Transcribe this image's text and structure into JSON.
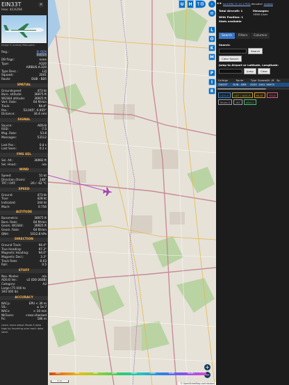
{
  "aircraft": {
    "callsign": "EIN33T",
    "hex_line": "Hex: 4CA294",
    "photo_credit": "Image © Andrzej Mahusatch",
    "hide_icon": "close-icon"
  },
  "info_rows": [
    {
      "k": "Reg.:",
      "v": "EI-DEN",
      "link": true
    },
    {
      "k": "",
      "v": "Ireland"
    },
    {
      "k": "DB flags:",
      "v": "none"
    },
    {
      "k": "Type:",
      "v": "A320"
    },
    {
      "k": "",
      "v": "AIRBUS A-320"
    },
    {
      "k": "Type Desc.:",
      "v": "L2J"
    },
    {
      "k": "Squawk:",
      "v": "2041"
    },
    {
      "k": "Route:",
      "v": "DUB - BER"
    }
  ],
  "sections": [
    {
      "title": "SPATIAL",
      "rows": [
        {
          "k": "Groundspeed:",
          "v": "473 kt"
        },
        {
          "k": "Baro. altitude:",
          "v": "36975 ft"
        },
        {
          "k": "WGS84 altitude:",
          "v": "36925 ft"
        },
        {
          "k": "Vert. Rate:",
          "v": "64 ft/min"
        },
        {
          "k": "Track:",
          "v": "94.4°"
        },
        {
          "k": "Pos.:",
          "v": "53.045°, 6.955°"
        },
        {
          "k": "Distance:",
          "v": "34.4 nmi"
        }
      ]
    },
    {
      "title": "SIGNAL",
      "rows": [
        {
          "k": "Source:",
          "v": "ADS-B"
        },
        {
          "k": "RSSI:",
          "v": "-7.5"
        },
        {
          "k": "Msg. Rate:",
          "v": "53.8"
        },
        {
          "k": "Messages:",
          "v": "53112"
        },
        {
          "k": "",
          "v": ""
        },
        {
          "k": "Last Pos.:",
          "v": "0.4 s"
        },
        {
          "k": "Last Seen:",
          "v": "0.1 s"
        }
      ]
    },
    {
      "title": "FMS SEL",
      "rows": [
        {
          "k": "Sel. Alt.:",
          "v": "36992 ft"
        },
        {
          "k": "Sel. Head.:",
          "v": "n/a"
        }
      ]
    },
    {
      "title": "WIND",
      "rows": [
        {
          "k": "Speed:",
          "v": "51 kt"
        },
        {
          "k": "Direction (from):",
          "v": "248°"
        },
        {
          "k": "TAT / OAT:",
          "v": "-26 / -62 °C"
        }
      ]
    },
    {
      "title": "SPEED",
      "rows": [
        {
          "k": "Ground:",
          "v": "473 kt"
        },
        {
          "k": "True:",
          "v": "428 kt"
        },
        {
          "k": "Indicated:",
          "v": "244 kt"
        },
        {
          "k": "Mach:",
          "v": "0.756"
        }
      ]
    },
    {
      "title": "ALTITUDE",
      "rows": [
        {
          "k": "Barometric:",
          "v": "36975 ft"
        },
        {
          "k": "Baro. Rate:",
          "v": "64 ft/min"
        },
        {
          "k": "Geom. WGS84:",
          "v": "36925 ft"
        },
        {
          "k": "Geom. Rate:",
          "v": "64 ft/min"
        },
        {
          "k": "QNH:",
          "v": "1012.8 hPa"
        }
      ]
    },
    {
      "title": "DIRECTION",
      "rows": [
        {
          "k": "Ground Track:",
          "v": "94.4°"
        },
        {
          "k": "True Heading:",
          "v": "97.3°"
        },
        {
          "k": "Magnetic Heading:",
          "v": "94.0°"
        },
        {
          "k": "Magnetic Decl.:",
          "v": "3.3°"
        },
        {
          "k": "Track Rate:",
          "v": "-0.03"
        },
        {
          "k": "Roll:",
          "v": "0.5"
        }
      ]
    },
    {
      "title": "STUFF",
      "rows": [
        {
          "k": "Nav. Modes:",
          "v": "n/a"
        },
        {
          "k": "ADS-B Ver.:",
          "v": "v2 (DO-260B)"
        },
        {
          "k": "Category:",
          "v": "A3"
        },
        {
          "k": "Large (75 000 to",
          "v": ""
        },
        {
          "k": "300 000 lb)",
          "v": ""
        }
      ]
    },
    {
      "title": "ACCURACY",
      "rows": [
        {
          "k": "NACp:",
          "v": "EPU < 30 m"
        },
        {
          "k": "SIL:",
          "v": "≤ 1e-7"
        },
        {
          "k": "NACv:",
          "v": "< 10 m/s"
        },
        {
          "k": "NICbaro:",
          "v": "cross-checked"
        },
        {
          "k": "Rc:",
          "v": "186 m"
        }
      ]
    }
  ],
  "footer": "Learn more about Mode-S data tags by hovering over each data label.",
  "map": {
    "top_buttons": [
      "U",
      "H",
      "T"
    ],
    "side_buttons": [
      "L",
      "O",
      "K",
      "M",
      "P",
      "I",
      "R"
    ],
    "pilot_circle": "chevron-right-icon",
    "zoom_in": "+",
    "zoom_out": "−",
    "alt_ticks": [
      "2000",
      "4000",
      "6000",
      "8000",
      "10000",
      "20000",
      "30000",
      "40000+"
    ],
    "scale_label": "5 nm",
    "attribution": "© OpenStreetMap contributors"
  },
  "header": {
    "version": "tar1090 (3.14.1793)",
    "decoder_text": "decoder:",
    "readsb": "readsb"
  },
  "stats": {
    "total_label": "Total Aircraft:",
    "total": "1",
    "messages_label": "Messages:",
    "messages_rate": "1856.1/sec",
    "with_pos_label": "With Position:",
    "with_pos": "1",
    "stats_avail": "Stats available"
  },
  "tabs": [
    {
      "label": "Search",
      "active": true
    },
    {
      "label": "Filters",
      "active": false
    },
    {
      "label": "Columns",
      "active": false
    }
  ],
  "search": {
    "label": "Search:",
    "search_button": "Search",
    "clear_button": "Clear Search",
    "jump_label": "Jump to Airport or Latitude, Longitude:",
    "jump_button": "Jump",
    "clear_small": "Clear"
  },
  "table": {
    "headers": [
      "Callsign",
      "Route",
      "Type",
      "Squawk",
      "Alt. (ft)",
      "Sp."
    ],
    "rows": [
      [
        "EIN33T",
        "DUB - BER",
        "A320",
        "2041",
        "36975",
        ""
      ]
    ]
  },
  "source_filters": [
    {
      "label": "ADS-B",
      "color": "#3f8edc"
    },
    {
      "label": "UAT / ADS-R",
      "color": "#b9a63a"
    },
    {
      "label": "MLAT",
      "color": "#e0a030"
    },
    {
      "label": "TIS-B",
      "color": "#e05a7a"
    },
    {
      "label": "Mode-S",
      "color": "#9aa0a6"
    },
    {
      "label": "AIS",
      "color": "#9aa0a6"
    },
    {
      "label": "ADS-C",
      "color": "#4ec07a"
    }
  ]
}
